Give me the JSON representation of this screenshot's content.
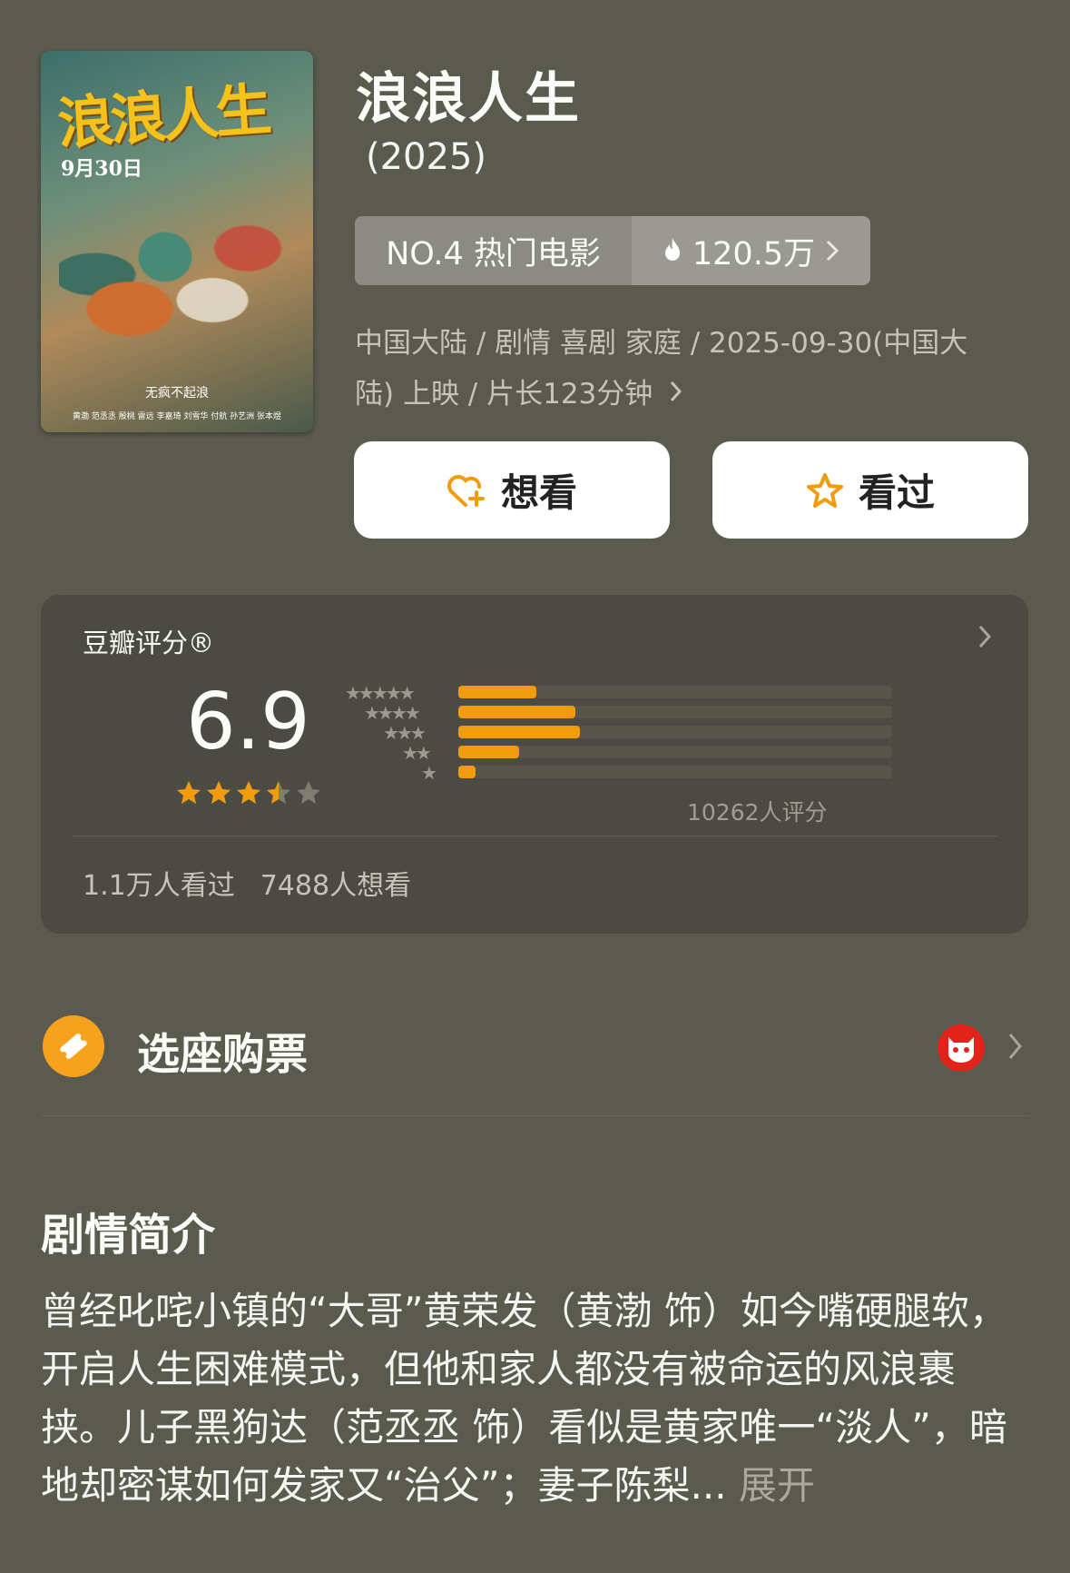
{
  "movie": {
    "title": "浪浪人生",
    "year": "(2025)",
    "poster": {
      "title_art": "浪浪人生",
      "release": "9月30日",
      "tagline": "无疯不起浪",
      "credits": "黄渤 范丞丞 殷桃 雷远 李嘉琦 刘雪华 付航 孙艺洲 张本煜"
    }
  },
  "rank": {
    "label": "NO.4 热门电影",
    "heat": "120.5万",
    "heat_icon": "flame-icon"
  },
  "meta": {
    "line1": "中国大陆 / 剧情 喜剧 家庭 / 2025-09-30(中国大",
    "line2": "陆) 上映 / 片长123分钟"
  },
  "actions": {
    "want": "想看",
    "seen": "看过"
  },
  "rating": {
    "label": "豆瓣评分®",
    "score": "6.9",
    "stars_value": 3.5,
    "distribution": [
      {
        "stars": 5,
        "fraction": 0.18
      },
      {
        "stars": 4,
        "fraction": 0.27
      },
      {
        "stars": 3,
        "fraction": 0.28
      },
      {
        "stars": 2,
        "fraction": 0.14
      },
      {
        "stars": 1,
        "fraction": 0.04
      }
    ],
    "count": "10262人评分",
    "watched": "1.1万人看过",
    "wish": "7488人想看"
  },
  "ticket": {
    "label": "选座购票",
    "icon": "ticket-icon",
    "provider_icon": "maoyan-cat-icon"
  },
  "synopsis": {
    "heading": "剧情简介",
    "text": "曾经叱咤小镇的“大哥”黄荣发（黄渤 饰）如今嘴硬腿软，开启人生困难模式，但他和家人都没有被命运的风浪裹挟。儿子黑狗达（范丞丞 饰）看似是黄家唯一“淡人”，暗地却密谋如何发家又“治父”；妻子陈梨...",
    "more": "展开"
  },
  "colors": {
    "background": "#5a5a4f",
    "accent": "#f29b0c",
    "card": "#4b4b43"
  }
}
